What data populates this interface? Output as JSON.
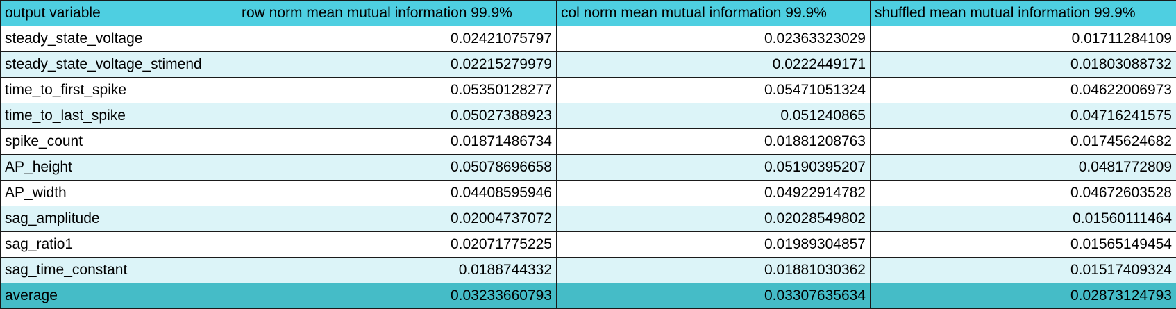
{
  "table": {
    "headers": [
      "output variable",
      "row norm mean mutual information 99.9%",
      "col norm mean mutual information 99.9%",
      "shuffled mean mutual information 99.9%"
    ],
    "rows": [
      [
        "steady_state_voltage",
        "0.02421075797",
        "0.02363323029",
        "0.01711284109"
      ],
      [
        "steady_state_voltage_stimend",
        "0.02215279979",
        "0.0222449171",
        "0.01803088732"
      ],
      [
        "time_to_first_spike",
        "0.05350128277",
        "0.05471051324",
        "0.04622006973"
      ],
      [
        "time_to_last_spike",
        "0.05027388923",
        "0.051240865",
        "0.04716241575"
      ],
      [
        "spike_count",
        "0.01871486734",
        "0.01881208763",
        "0.01745624682"
      ],
      [
        "AP_height",
        "0.05078696658",
        "0.05190395207",
        "0.0481772809"
      ],
      [
        "AP_width",
        "0.04408595946",
        "0.04922914782",
        "0.04672603528"
      ],
      [
        "sag_amplitude",
        "0.02004737072",
        "0.02028549802",
        "0.01560111464"
      ],
      [
        "sag_ratio1",
        "0.02071775225",
        "0.01989304857",
        "0.01565149454"
      ],
      [
        "sag_time_constant",
        "0.0188744332",
        "0.01881030362",
        "0.01517409324"
      ]
    ],
    "footer": [
      "average",
      "0.03233660793",
      "0.03307635634",
      "0.02873124793"
    ]
  },
  "colors": {
    "header_bg": "#4ecfe1",
    "row_alt_bg": "#dcf4f8",
    "row_bg": "#ffffff",
    "footer_bg": "#45bcc7"
  }
}
